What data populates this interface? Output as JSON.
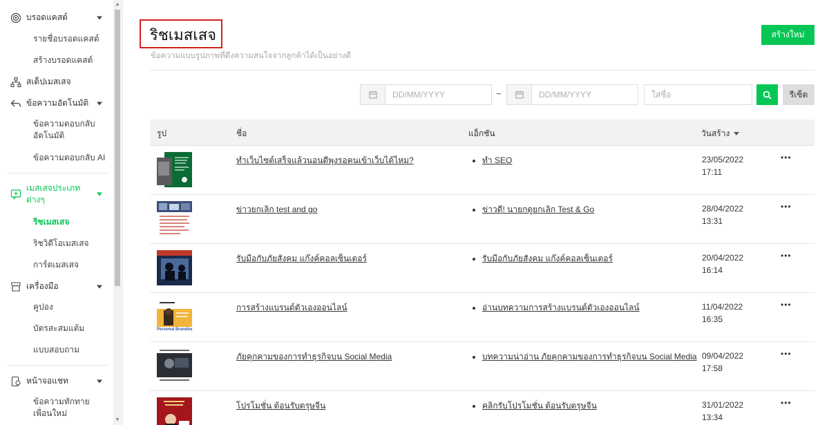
{
  "sidebar": {
    "broadcast": {
      "label": "บรอดแคสต์",
      "items": [
        "รายชื่อบรอดแคสต์",
        "สร้างบรอดแคสต์"
      ]
    },
    "step_message": {
      "label": "สเต็ปเมสเสจ"
    },
    "auto_message": {
      "label": "ข้อความอัตโนมัติ",
      "items": [
        "ข้อความตอบกลับ อัตโนมัติ",
        "ข้อความตอบกลับ AI"
      ]
    },
    "message_types": {
      "label": "เมสเสจประเภท ต่างๆ",
      "items": [
        "ริชเมสเสจ",
        "ริชวิดีโอเมสเสจ",
        "การ์ดเมสเสจ"
      ]
    },
    "tools": {
      "label": "เครื่องมือ",
      "items": [
        "คูปอง",
        "บัตรสะสมแต้ม",
        "แบบสอบถาม"
      ]
    },
    "chat_screen": {
      "label": "หน้าจอแชท",
      "items": [
        "ข้อความทักทาย เพื่อนใหม่"
      ]
    }
  },
  "header": {
    "title": "ริชเมสเสจ",
    "subtitle": "ข้อความแบบรูปภาพที่ดึงความสนใจจากลูกค้าได้เป็นอย่างดี",
    "create_label": "สร้างใหม่"
  },
  "filters": {
    "date_from_placeholder": "DD/MM/YYYY",
    "date_to_placeholder": "DD/MM/YYYY",
    "separator": "~",
    "name_placeholder": "ใส่ชื่อ",
    "reset_label": "รีเซ็ต"
  },
  "table": {
    "columns": {
      "image": "รูป",
      "name": "ชื่อ",
      "action": "แอ็กชัน",
      "created": "วันสร้าง"
    },
    "rows": [
      {
        "name": "ทำเว็บไซต์เสร็จแล้วนอนดีพุงรอคนเข้าเว็บได้ไหม?",
        "action": "ทำ SEO",
        "date": "23/05/2022",
        "time": "17:11",
        "more": "•••"
      },
      {
        "name": "ข่าวยกเลิก test and go",
        "action": "ข่าวดี! นายกดูยกเลิก Test & Go",
        "date": "28/04/2022",
        "time": "13:31",
        "more": "•••"
      },
      {
        "name": "รับมือกับภัยสังคม แก๊งค์คอลเซ็นเตอร์",
        "action": "รับมือกับภัยสังคม แก๊งค์คอลเซ็นเตอร์",
        "date": "20/04/2022",
        "time": "16:14",
        "more": "•••"
      },
      {
        "name": "การสร้างแบรนด์ตัวเองออนไลน์",
        "action": "อ่านบทความการสร้างแบรนด์ตัวเองออนไลน์",
        "date": "11/04/2022",
        "time": "16:35",
        "more": "•••"
      },
      {
        "name": "ภัยคุกคามของการทำธุรกิจบน Social Media",
        "action": "บทความน่าอ่าน ภัยคุกคามของการทำธุรกิจบน Social Media",
        "date": "09/04/2022",
        "time": "17:58",
        "more": "•••"
      },
      {
        "name": "โปรโมชั่น ต้อนรับตรุษจีน",
        "action": "คลิกรับโปรโมชั่น ต้อนรับตรุษจีน",
        "date": "31/01/2022",
        "time": "13:34",
        "more": "•••"
      }
    ]
  },
  "thumbs": {
    "t4_text": "Personal Branding"
  },
  "colors": {
    "brand_green": "#06c755",
    "highlight_red": "#d42020"
  }
}
